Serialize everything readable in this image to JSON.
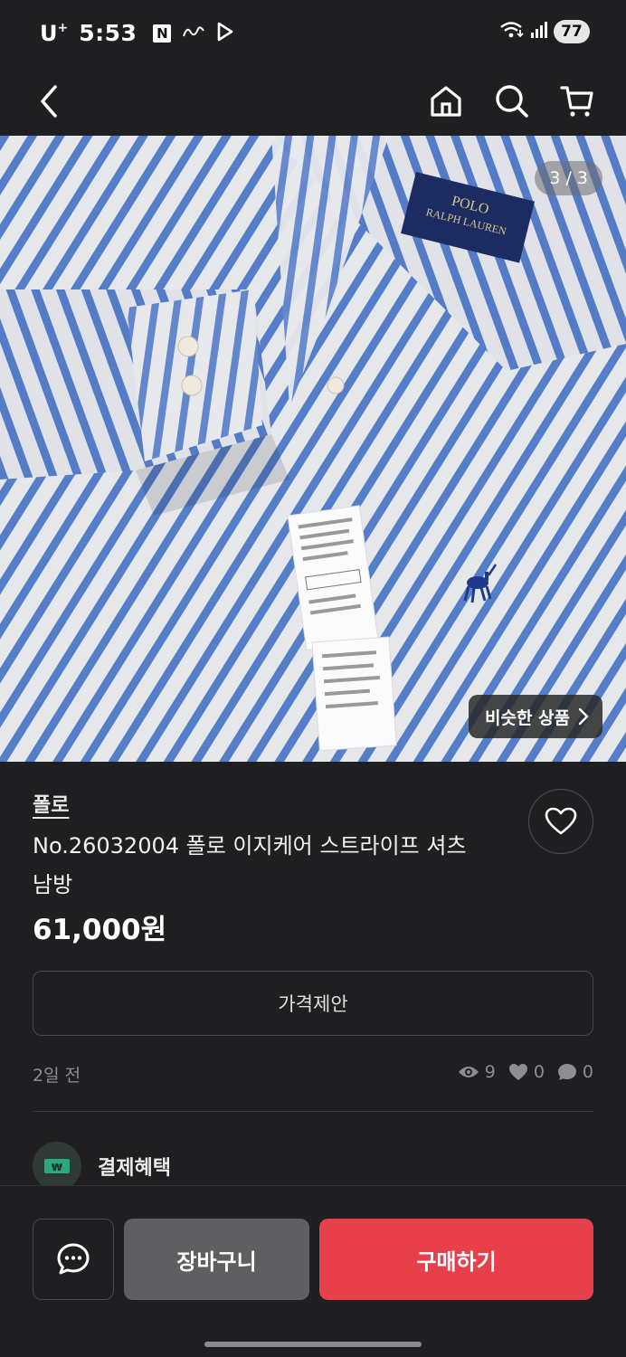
{
  "status_bar": {
    "carrier": "U",
    "carrier_sup": "+",
    "time": "5:53",
    "notification_n": "N",
    "battery": "77"
  },
  "top_bar": {
    "back_icon": "chevron-left-icon",
    "home_icon": "home-icon",
    "search_icon": "search-icon",
    "cart_icon": "cart-icon"
  },
  "gallery": {
    "counter": "3 / 3",
    "similar_label": "비슷한 상품",
    "image_description": "blue and white striped shirt"
  },
  "product": {
    "brand": "폴로",
    "title": "No.26032004 폴로 이지케어 스트라이프 셔츠 남방",
    "price": "61,000원",
    "offer_button": "가격제안",
    "posted": "2일 전",
    "views": "9",
    "likes": "0",
    "chats": "0"
  },
  "benefit": {
    "label": "결제혜택"
  },
  "bottom_bar": {
    "cart_label": "장바구니",
    "buy_label": "구매하기"
  },
  "colors": {
    "background": "#1f1f21",
    "buy_accent": "#e8404b",
    "cart_gray": "#5f5f62",
    "stripe_blue": "#5b86d6"
  }
}
